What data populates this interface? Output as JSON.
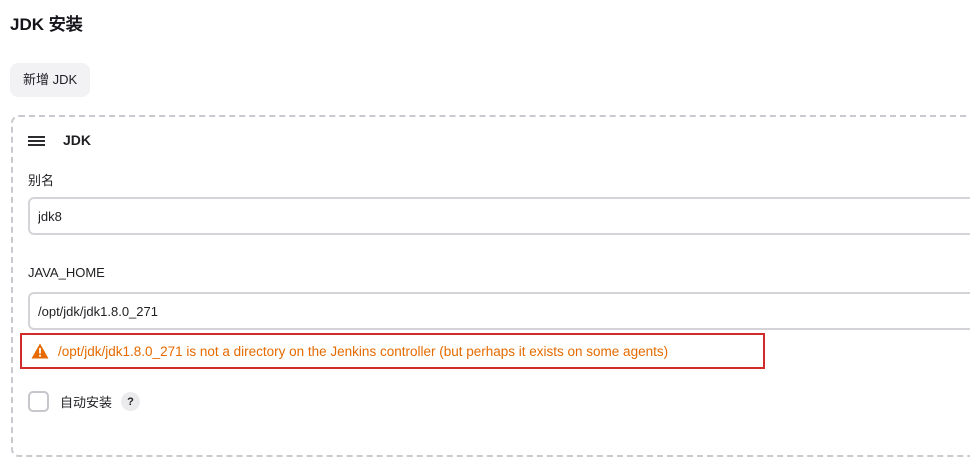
{
  "section": {
    "title": "JDK 安装"
  },
  "toolbar": {
    "add_label": "新增 JDK"
  },
  "card": {
    "title": "JDK",
    "alias": {
      "label": "别名",
      "value": "jdk8"
    },
    "java_home": {
      "label": "JAVA_HOME",
      "value": "/opt/jdk/jdk1.8.0_271",
      "warning": "/opt/jdk/jdk1.8.0_271 is not a directory on the Jenkins controller (but perhaps it exists on some agents)"
    },
    "auto_install": {
      "label": "自动安装",
      "checked": false,
      "help": "?"
    }
  },
  "colors": {
    "warning_text": "#e56a00",
    "warning_border": "#d12b2b",
    "dashed_border": "#c9c9cf"
  },
  "icons": {
    "drag_handle": "hamburger-icon",
    "warning": "warning-triangle-icon",
    "help": "help-icon"
  }
}
